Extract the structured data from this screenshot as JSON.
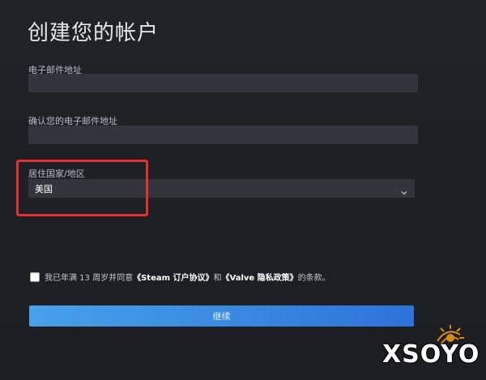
{
  "page": {
    "title": "创建您的帐户"
  },
  "form": {
    "email_label": "电子邮件地址",
    "email_value": "",
    "confirm_label": "确认您的电子邮件地址",
    "confirm_value": "",
    "country_label": "居住国家/地区",
    "country_value": "美国",
    "country_chevron_icon": "chevron-down-icon"
  },
  "agreement": {
    "checked": false,
    "prefix": "我已年满 13 周岁并同意",
    "link1": "《Steam 订户协议》",
    "middle": "和",
    "link2": "《Valve 隐私政策》",
    "suffix": "的条款。"
  },
  "actions": {
    "continue_label": "继续"
  },
  "annotation": {
    "highlight_color": "#e53030"
  },
  "watermark": {
    "text": "XSOYO",
    "icon": "sun-logo-icon",
    "color": "#d98a1a"
  }
}
